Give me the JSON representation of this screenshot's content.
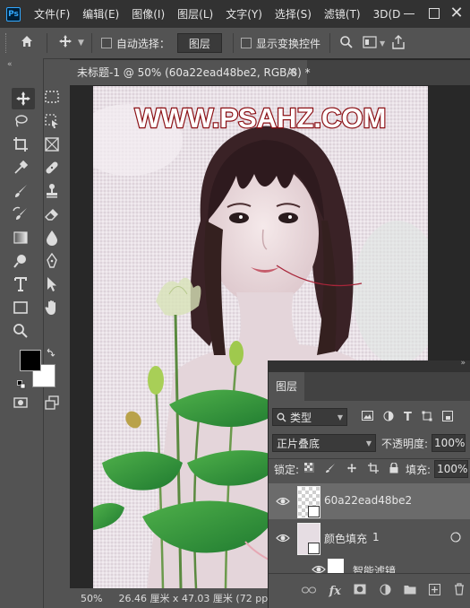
{
  "menu": {
    "logo": "Ps",
    "items": [
      "文件(F)",
      "编辑(E)",
      "图像(I)",
      "图层(L)",
      "文字(Y)",
      "选择(S)",
      "滤镜(T)",
      "3D(D"
    ]
  },
  "options_bar": {
    "auto_select_label": "自动选择：",
    "auto_select_value": "图层",
    "show_transform_label": "显示变换控件"
  },
  "document": {
    "tab_title": "未标题-1 @ 50% (60a22ead48be2, RGB/8) *",
    "watermark": "WWW.PSAHZ.COM"
  },
  "status": {
    "zoom": "50%",
    "info": "26.46 厘米 x 47.03 厘米 (72 ppi)"
  },
  "layers_panel": {
    "tab": "图层",
    "filter_kind": "类型",
    "blend_mode": "正片叠底",
    "opacity_label": "不透明度:",
    "opacity_value": "100%",
    "lock_label": "锁定:",
    "fill_label": "填充:",
    "fill_value": "100%",
    "layers": [
      {
        "name": "60a22ead48be2",
        "selected": true
      },
      {
        "name": "颜色填充",
        "number": "1",
        "selected": false
      },
      {
        "name": "智能滤镜",
        "selected": false
      }
    ]
  },
  "colors": {
    "foreground": "#000000",
    "background": "#ffffff",
    "watermark_fill": "#ffffff",
    "watermark_stroke": "#8b0f14"
  }
}
